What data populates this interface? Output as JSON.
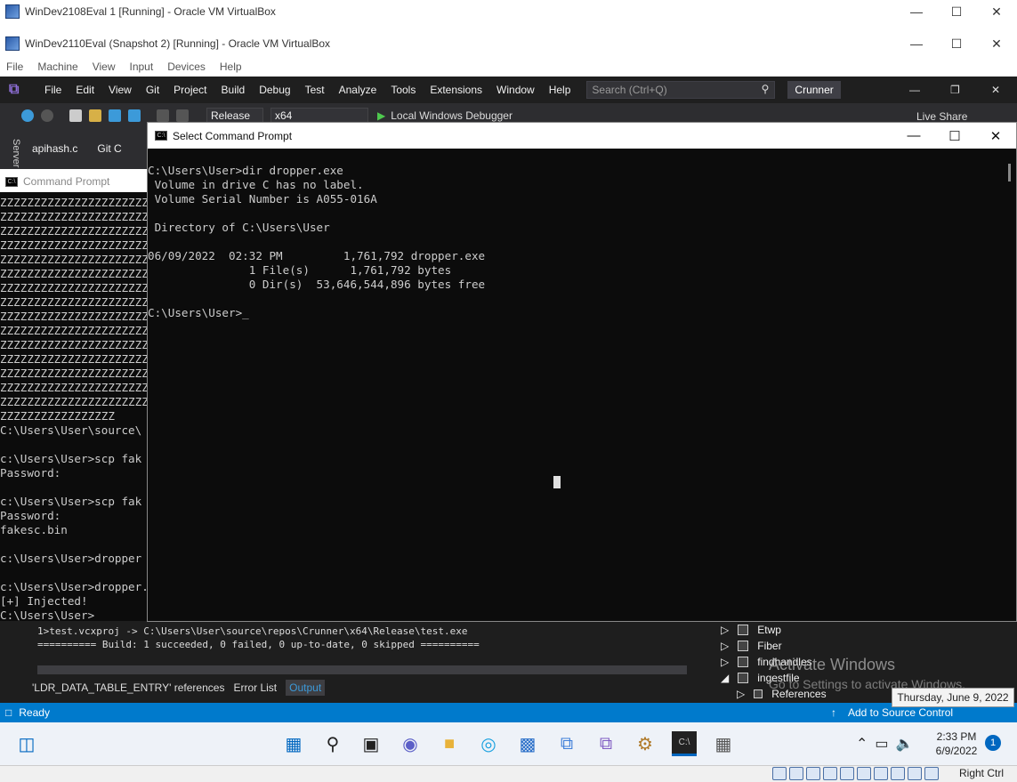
{
  "outer_window": {
    "title": "WinDev2108Eval 1 [Running] - Oracle VM VirtualBox"
  },
  "inner_window": {
    "title": "WinDev2110Eval (Snapshot 2) [Running] - Oracle VM VirtualBox"
  },
  "vbox_menu": [
    "File",
    "Machine",
    "View",
    "Input",
    "Devices",
    "Help"
  ],
  "vs": {
    "menu": [
      "File",
      "Edit",
      "View",
      "Git",
      "Project",
      "Build",
      "Debug",
      "Test",
      "Analyze",
      "Tools",
      "Extensions",
      "Window",
      "Help"
    ],
    "search_placeholder": "Search (Ctrl+Q)",
    "solution_name": "Crunner",
    "config": "Release",
    "platform": "x64",
    "debugger": "Local Windows Debugger",
    "live_share": "Live Share",
    "doc_tab": "apihash.c",
    "git_tab": "Git C",
    "server_tab": "Server",
    "output_lines": [
      "1>test.vcxproj -> C:\\Users\\User\\source\\repos\\Crunner\\x64\\Release\\test.exe",
      "========== Build: 1 succeeded, 0 failed, 0 up-to-date, 0 skipped =========="
    ],
    "bottom_tabs": [
      "'LDR_DATA_TABLE_ENTRY' references",
      "Error List",
      "Output"
    ],
    "tree_items": [
      "Etwp",
      "Fiber",
      "findhandles",
      "ingestfile",
      "References"
    ],
    "status_ready": "Ready",
    "status_source": "Add to Source Control",
    "activate_title": "Activate Windows",
    "activate_sub": "Go to Settings to activate Windows."
  },
  "date_tooltip": "Thursday, June 9, 2022",
  "bg_cmd": {
    "title": "Command Prompt",
    "lines": [
      "ZZZZZZZZZZZZZZZZZZZZZZZ",
      "ZZZZZZZZZZZZZZZZZZZZZZZ",
      "ZZZZZZZZZZZZZZZZZZZZZZZ",
      "ZZZZZZZZZZZZZZZZZZZZZZZ",
      "ZZZZZZZZZZZZZZZZZZZZZZZ",
      "ZZZZZZZZZZZZZZZZZZZZZZZ",
      "ZZZZZZZZZZZZZZZZZZZZZZZ",
      "ZZZZZZZZZZZZZZZZZZZZZZZ",
      "ZZZZZZZZZZZZZZZZZZZZZZZ",
      "ZZZZZZZZZZZZZZZZZZZZZZZ",
      "ZZZZZZZZZZZZZZZZZZZZZZZ",
      "ZZZZZZZZZZZZZZZZZZZZZZZ",
      "ZZZZZZZZZZZZZZZZZZZZZZZ",
      "ZZZZZZZZZZZZZZZZZZZZZZZ",
      "ZZZZZZZZZZZZZZZZZZZZZZZ",
      "ZZZZZZZZZZZZZZZZZ",
      "C:\\Users\\User\\source\\",
      "",
      "c:\\Users\\User>scp fak",
      "Password:",
      "",
      "c:\\Users\\User>scp fak",
      "Password:",
      "fakesc.bin",
      "",
      "c:\\Users\\User>dropper",
      "",
      "c:\\Users\\User>dropper.exe",
      "[+] Injected!",
      "C:\\Users\\User>"
    ]
  },
  "fg_cmd": {
    "title": "Select Command Prompt",
    "lines": [
      "C:\\Users\\User>dir dropper.exe",
      " Volume in drive C has no label.",
      " Volume Serial Number is A055-016A",
      "",
      " Directory of C:\\Users\\User",
      "",
      "06/09/2022  02:32 PM         1,761,792 dropper.exe",
      "               1 File(s)      1,761,792 bytes",
      "               0 Dir(s)  53,646,544,896 bytes free",
      "",
      "C:\\Users\\User>_"
    ]
  },
  "clock": {
    "time": "2:33 PM",
    "date": "6/9/2022"
  },
  "notification_count": "1",
  "vbox_host_key": "Right Ctrl"
}
